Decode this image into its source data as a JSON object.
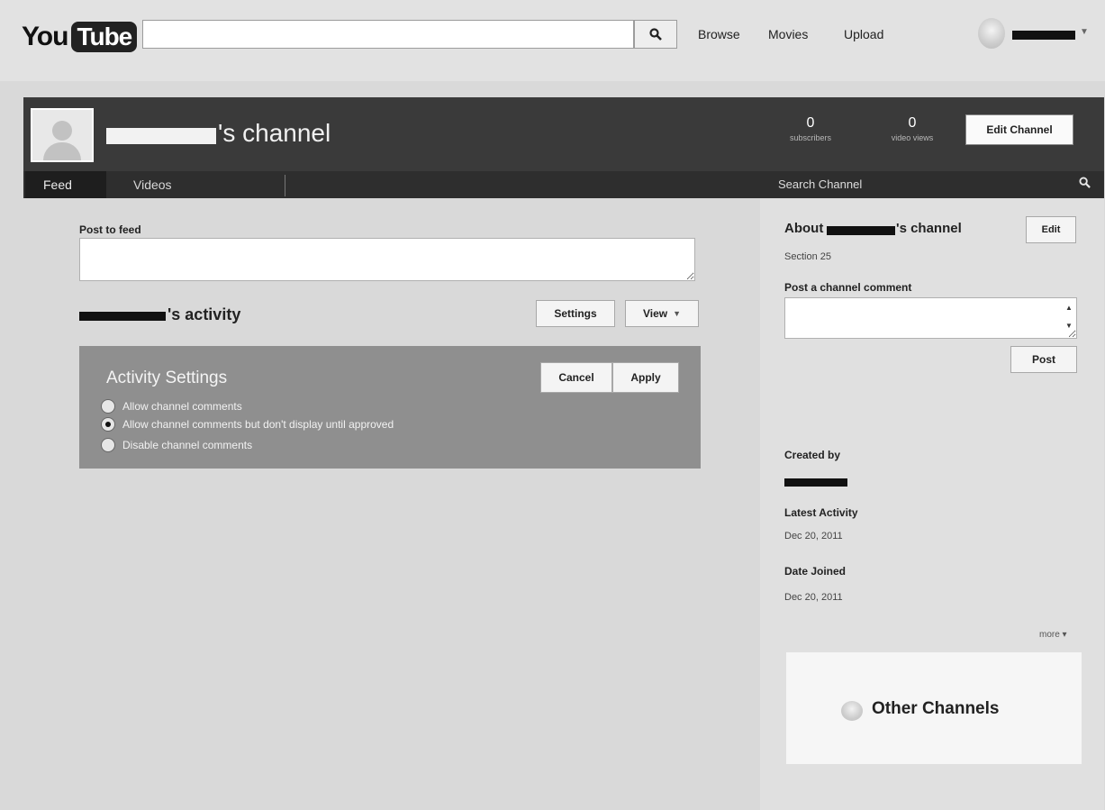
{
  "masthead": {
    "logo_you": "You",
    "logo_tube": "Tube",
    "search_value": "",
    "nav": {
      "browse": "Browse",
      "movies": "Movies",
      "upload": "Upload"
    }
  },
  "channel": {
    "title_suffix": "'s channel",
    "subscribers_count": "0",
    "subscribers_label": "subscribers",
    "views_count": "0",
    "views_label": "video views",
    "edit_channel_label": "Edit Channel",
    "tabs": {
      "feed": "Feed",
      "videos": "Videos"
    },
    "search_placeholder": "Search Channel"
  },
  "main": {
    "post_label": "Post to feed",
    "post_value": "",
    "activity_heading": "'s activity",
    "settings_label": "Settings",
    "view_label": "View",
    "activity_settings": {
      "title": "Activity Settings",
      "cancel_label": "Cancel",
      "apply_label": "Apply",
      "options": [
        {
          "label": "Allow channel comments",
          "checked": false
        },
        {
          "label": "Allow channel comments but don't display until approved",
          "checked": true
        },
        {
          "label": "Disable channel comments",
          "checked": false
        }
      ]
    }
  },
  "sidebar": {
    "about_prefix": "About",
    "about_suffix": "'s channel",
    "edit_label": "Edit",
    "section": "Section 25",
    "comment_label": "Post a channel comment",
    "comment_value": "",
    "post_label": "Post",
    "created_label": "Created by",
    "latest_label": "Latest Activity",
    "latest_value": "Dec 20, 2011",
    "joined_label": "Date Joined",
    "joined_value": "Dec 20, 2011",
    "more_label": "more ▾",
    "other_channels_label": "Other Channels"
  },
  "icons": {
    "search": "search-icon",
    "avatar": "avatar-icon",
    "caret": "chevron-down-icon"
  }
}
